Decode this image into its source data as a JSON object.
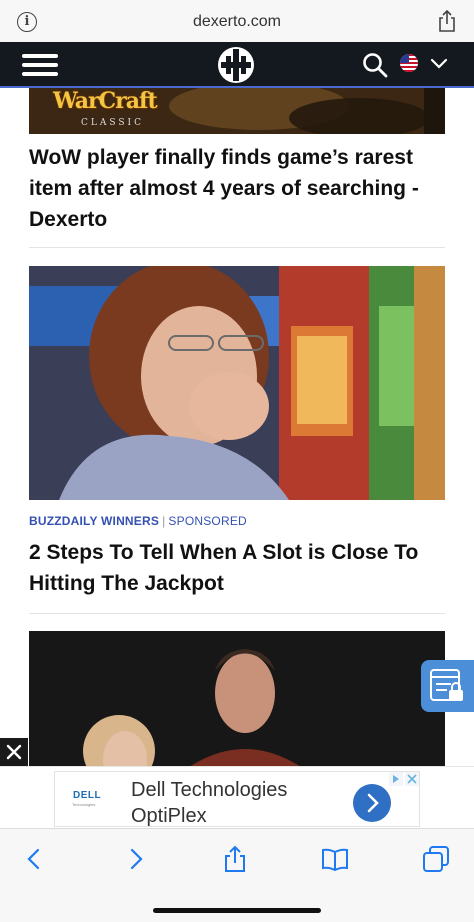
{
  "browser": {
    "domain": "dexerto.com"
  },
  "articles": [
    {
      "image_logo": "WarCraft",
      "image_logo_sub": "CLASSIC",
      "headline": "WoW player finally finds game’s rarest item after almost 4 years of searching - Dexerto"
    },
    {
      "source": "BUZZDAILY WINNERS",
      "separator": "|",
      "label": "SPONSORED",
      "headline": "2 Steps To Tell When A Slot is Close To Hitting The Jackpot"
    }
  ],
  "ad": {
    "brand": "DELL",
    "brand_sub": "Technologies",
    "title_line1": "Dell Technologies",
    "title_line2": "OptiPlex"
  },
  "icons": {
    "info": "info-icon",
    "share": "share-icon",
    "menu": "hamburger-menu-icon",
    "logo": "dexerto-logo",
    "search": "search-icon",
    "flag": "us-flag-icon",
    "chevron": "chevron-down-icon",
    "side": "privacy-settings-icon",
    "close": "close-icon",
    "back": "back-icon",
    "forward": "forward-icon",
    "bookmarks": "bookmarks-icon",
    "tabs": "tabs-icon"
  },
  "colors": {
    "header_bg": "#14191f",
    "accent": "#4b6bd0",
    "sponsor_link": "#3451b2",
    "safari_blue": "#1f7af2"
  }
}
